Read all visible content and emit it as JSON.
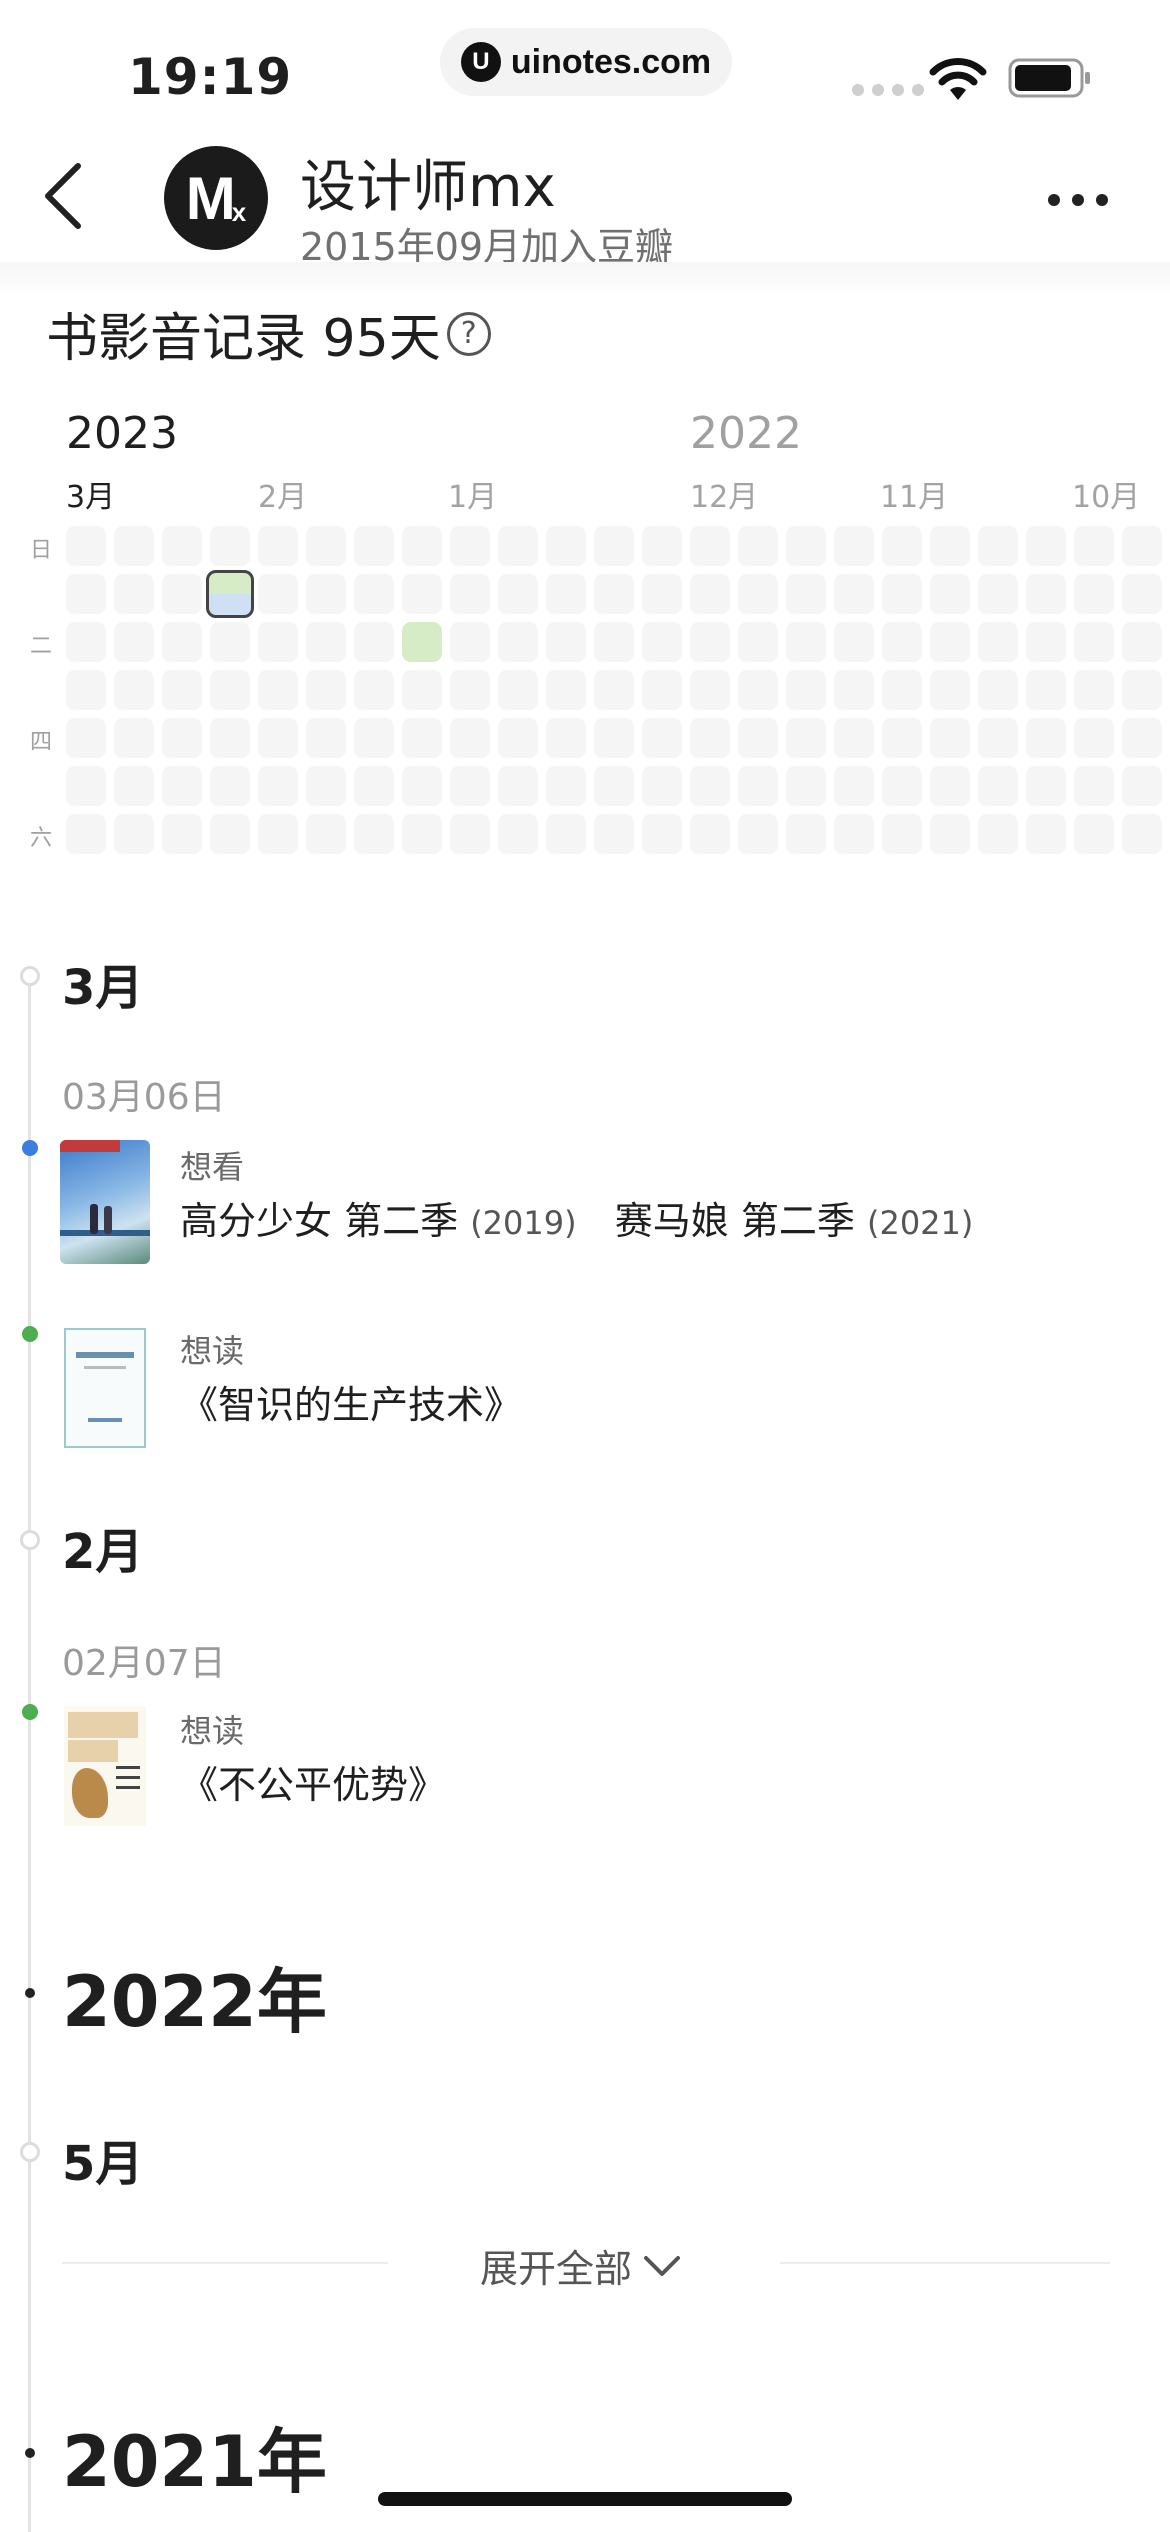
{
  "status_bar": {
    "time": "19:19",
    "url": "uinotes.com",
    "url_icon_letter": "U"
  },
  "header": {
    "avatar_letter": "M",
    "avatar_sub": "x",
    "username": "设计师mx",
    "joined": "2015年09月加入豆瓣"
  },
  "record": {
    "title": "书影音记录 95天",
    "help_glyph": "?",
    "years": [
      "2023",
      "2022"
    ],
    "months": [
      "3月",
      "2月",
      "1月",
      "12月",
      "11月",
      "10月"
    ],
    "weekdays": [
      "日",
      "二",
      "四",
      "六"
    ],
    "colors": {
      "empty": "#f5f5f5",
      "watch": "#d6ecc6",
      "read": "#cfe0f5",
      "mixed_border": "#444444"
    }
  },
  "timeline": {
    "m1": "3月",
    "d1": "03月06日",
    "e1": {
      "action": "想看",
      "items": [
        {
          "title": "高分少女 第二季",
          "year": "(2019)"
        },
        {
          "title": "赛马娘 第二季",
          "year": "(2021)"
        }
      ]
    },
    "e2": {
      "action": "想读",
      "title": "《智识的生产技术》"
    },
    "m2": "2月",
    "d2": "02月07日",
    "e3": {
      "action": "想读",
      "title": "《不公平优势》"
    },
    "y1": "2022年",
    "m3": "5月",
    "expand_label": "展开全部",
    "y2": "2021年",
    "dot_colors": {
      "watch": "#3b7de0",
      "read": "#4cae50"
    }
  }
}
